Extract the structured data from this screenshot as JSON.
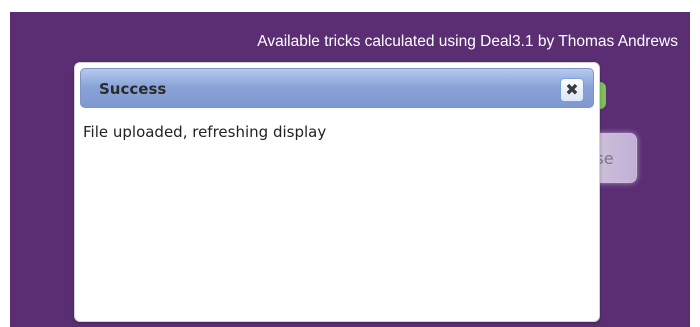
{
  "page": {
    "credit_text": "Available tricks calculated using Deal3.1 by Thomas Andrews"
  },
  "dialog": {
    "title": "Success",
    "close_icon_glyph": "✖",
    "message": "File uploaded, refreshing display"
  },
  "background_button": {
    "label": "Close"
  },
  "colors": {
    "backdrop": "#5b2e73",
    "titlebar": "#8aa4d9",
    "accent_green": "#7dc05a"
  }
}
